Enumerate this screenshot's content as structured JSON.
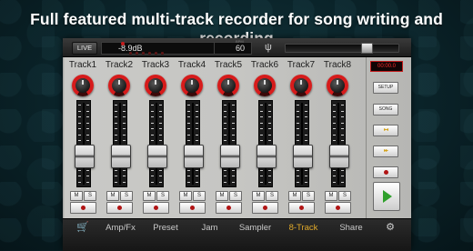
{
  "headline": "Full featured multi-track recorder for song writing and recording",
  "topbar": {
    "live_label": "LIVE",
    "level_display": "-8.9dB",
    "tempo_display": "60",
    "tempo_unit": "BPM",
    "tuner_icon": "tuning-fork-icon",
    "master_level": 0.75
  },
  "tracks": [
    {
      "label": "Track1",
      "mute_label": "M",
      "solo_label": "S",
      "knob_icon": "pan-knob-icon",
      "fader_level": 0.3
    },
    {
      "label": "Track2",
      "mute_label": "M",
      "solo_label": "S",
      "knob_icon": "pan-knob-icon",
      "fader_level": 0.3
    },
    {
      "label": "Track3",
      "mute_label": "M",
      "solo_label": "S",
      "knob_icon": "pan-knob-icon",
      "fader_level": 0.3
    },
    {
      "label": "Track4",
      "mute_label": "M",
      "solo_label": "S",
      "knob_icon": "pan-knob-icon",
      "fader_level": 0.3
    },
    {
      "label": "Track5",
      "mute_label": "M",
      "solo_label": "S",
      "knob_icon": "pan-knob-icon",
      "fader_level": 0.3
    },
    {
      "label": "Track6",
      "mute_label": "M",
      "solo_label": "S",
      "knob_icon": "pan-knob-icon",
      "fader_level": 0.3
    },
    {
      "label": "Track7",
      "mute_label": "M",
      "solo_label": "S",
      "knob_icon": "pan-knob-icon",
      "fader_level": 0.3
    },
    {
      "label": "Track8",
      "mute_label": "M",
      "solo_label": "S",
      "knob_icon": "pan-knob-icon",
      "fader_level": 0.3
    }
  ],
  "controls": {
    "timecode": "00:00.0",
    "setup_label": "SETUP",
    "song_label": "SONG",
    "rewind_icon": "rewind-to-start-icon",
    "rewind_glyph": "▸◂",
    "forward_icon": "fast-forward-icon",
    "forward_glyph": "▸▸",
    "record_icon": "record-icon",
    "play_icon": "play-icon"
  },
  "bottom_nav": [
    {
      "key": "cart",
      "label": "",
      "icon": "shopping-cart-icon",
      "glyph": "🛒"
    },
    {
      "key": "ampfx",
      "label": "Amp/Fx"
    },
    {
      "key": "preset",
      "label": "Preset"
    },
    {
      "key": "jam",
      "label": "Jam"
    },
    {
      "key": "sampler",
      "label": "Sampler"
    },
    {
      "key": "8track",
      "label": "8-Track",
      "active": true
    },
    {
      "key": "share",
      "label": "Share"
    },
    {
      "key": "settings",
      "label": "",
      "icon": "gear-icon",
      "glyph": "⚙"
    }
  ],
  "colors": {
    "accent_active": "#e0a92a",
    "record_red": "#b01414",
    "play_green": "#2fa02c",
    "timecode_red": "#ff2a2a"
  }
}
